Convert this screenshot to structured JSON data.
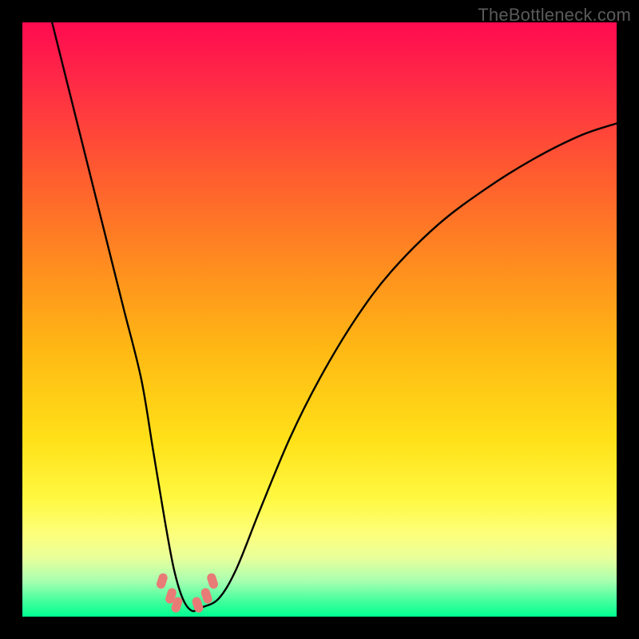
{
  "watermark": "TheBottleneck.com",
  "chart_data": {
    "type": "line",
    "title": "",
    "xlabel": "",
    "ylabel": "",
    "xlim": [
      0,
      100
    ],
    "ylim": [
      0,
      100
    ],
    "series": [
      {
        "name": "curve",
        "x": [
          5,
          8,
          11,
          14,
          17,
          20,
          22,
          24,
          25.5,
          27,
          28.5,
          30,
          33,
          36,
          40,
          45,
          50,
          56,
          62,
          70,
          78,
          86,
          94,
          100
        ],
        "y": [
          100,
          88,
          76,
          64,
          52,
          40,
          28,
          16,
          8,
          3,
          1,
          1.5,
          3,
          8,
          18,
          30,
          40,
          50,
          58,
          66,
          72,
          77,
          81,
          83
        ]
      },
      {
        "name": "markers",
        "x": [
          23.5,
          25.0,
          26.0,
          29.5,
          31.0,
          32.0
        ],
        "y": [
          6.0,
          3.5,
          2.0,
          2.0,
          3.5,
          6.0
        ]
      }
    ],
    "marker_color": "#e97b77",
    "curve_color": "#000000",
    "curve_width": 2.4,
    "marker_radius_px": 7
  }
}
